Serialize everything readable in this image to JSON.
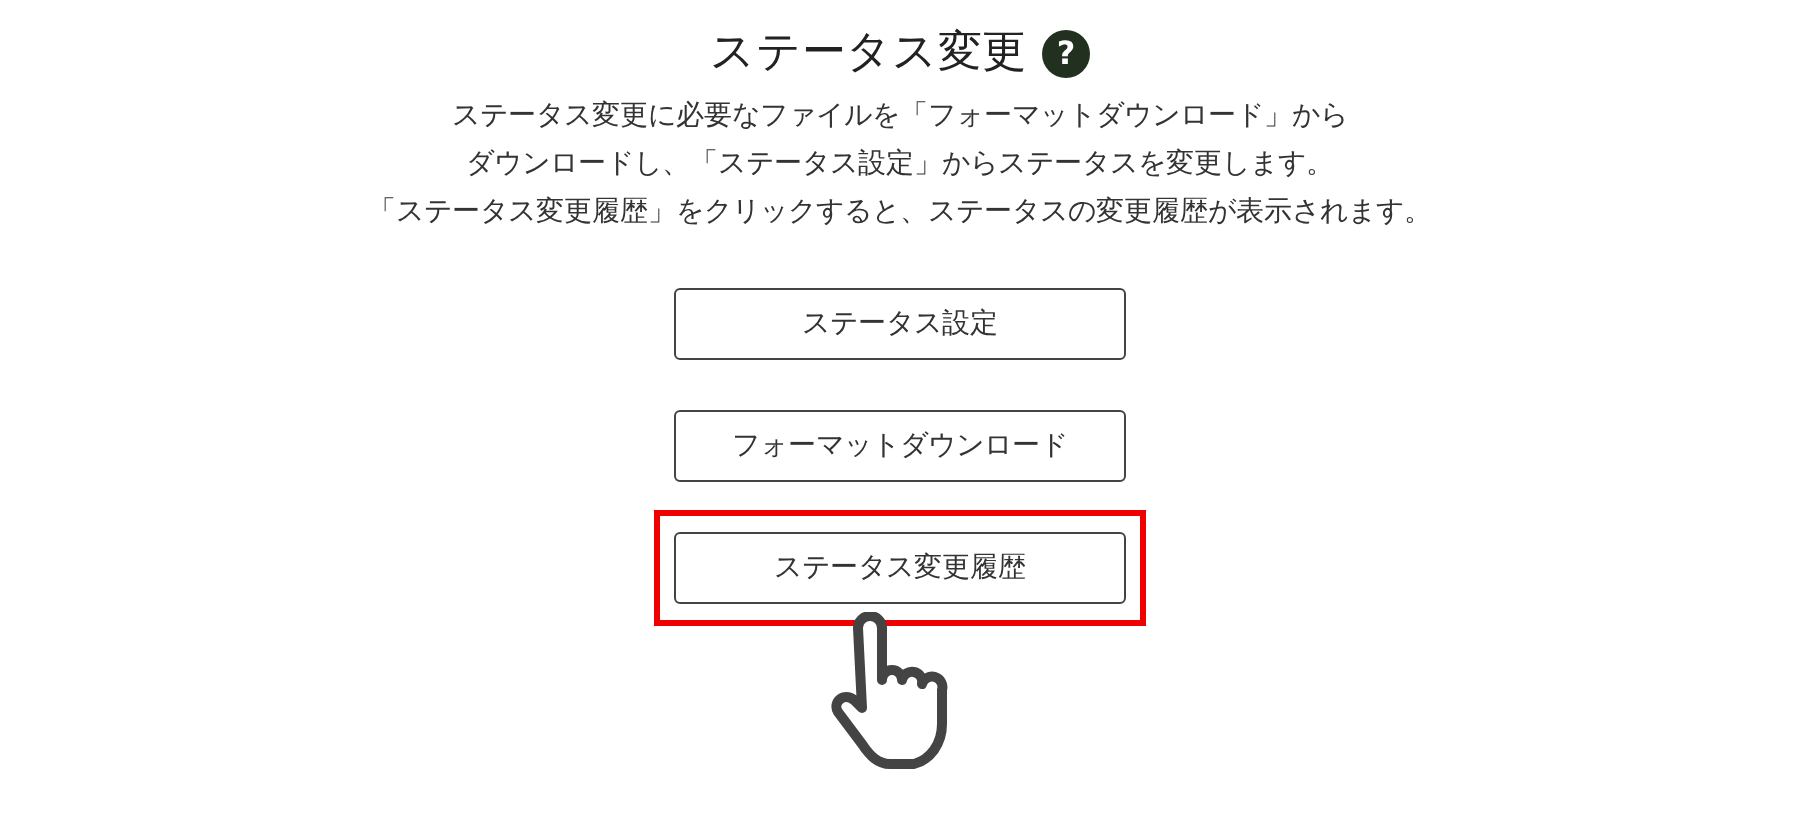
{
  "title": "ステータス変更",
  "help_icon": "?",
  "description": [
    "ステータス変更に必要なファイルを「フォーマットダウンロード」から",
    "ダウンロードし、「ステータス設定」からステータスを変更します。",
    "「ステータス変更履歴」をクリックすると、ステータスの変更履歴が表示されます。"
  ],
  "buttons": [
    {
      "label": "ステータス設定",
      "highlighted": false
    },
    {
      "label": "フォーマットダウンロード",
      "highlighted": false
    },
    {
      "label": "ステータス変更履歴",
      "highlighted": true
    }
  ]
}
